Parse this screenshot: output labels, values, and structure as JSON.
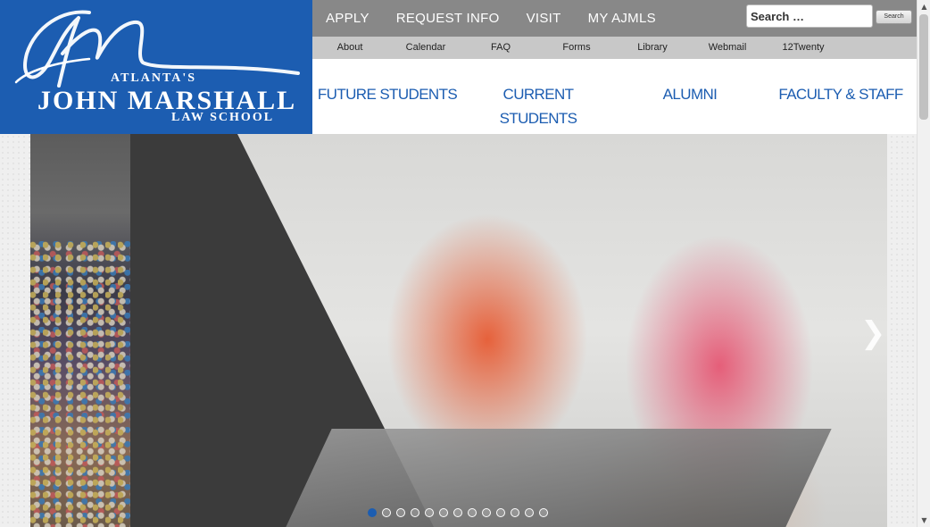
{
  "logo": {
    "line1": "ATLANTA'S",
    "line2": "JOHN MARSHALL",
    "line3": "LAW SCHOOL"
  },
  "topnav": {
    "items": [
      "APPLY",
      "REQUEST INFO",
      "VISIT",
      "MY AJMLS"
    ]
  },
  "search": {
    "placeholder": "Search …",
    "button_label": "Search"
  },
  "subnav": {
    "items": [
      "About",
      "Calendar",
      "FAQ",
      "Forms",
      "Library",
      "Webmail",
      "12Twenty"
    ]
  },
  "mainnav": {
    "items": [
      "FUTURE STUDENTS",
      "CURRENT STUDENTS",
      "ALUMNI",
      "FACULTY & STAFF"
    ]
  },
  "slider": {
    "next_icon": "chevron-right-icon",
    "dot_count": 13,
    "active_index": 0
  },
  "colors": {
    "brand_blue": "#1c5db1",
    "topbar_gray": "#888888",
    "subnav_gray": "#c8c8c8"
  }
}
